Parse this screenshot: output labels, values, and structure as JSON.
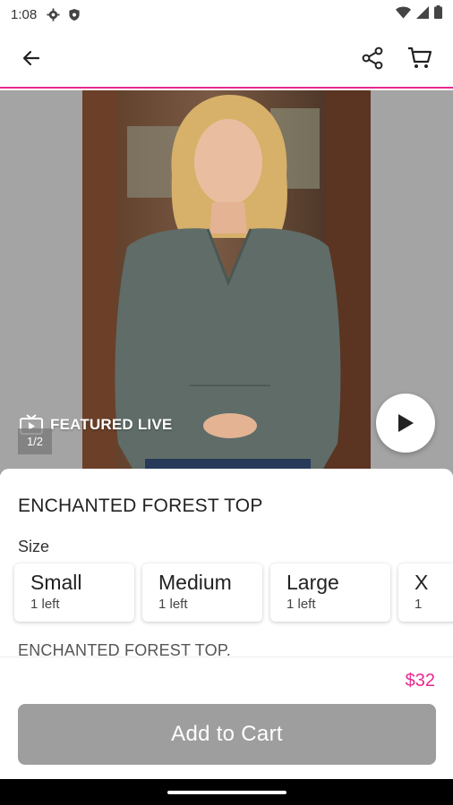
{
  "status_bar": {
    "time": "1:08",
    "icons": [
      "gear-icon",
      "shield-icon",
      "wifi-icon",
      "signal-icon",
      "battery-icon"
    ]
  },
  "header": {
    "back_icon": "arrow-left-icon",
    "share_icon": "share-icon",
    "cart_icon": "cart-icon",
    "accent_color": "#e8288f"
  },
  "media": {
    "featured_label": "FEATURED LIVE",
    "page_indicator": "1/2",
    "play_icon": "play-icon"
  },
  "product": {
    "title": "ENCHANTED FOREST TOP",
    "size_label": "Size",
    "sizes": [
      {
        "name": "Small",
        "stock": "1 left"
      },
      {
        "name": "Medium",
        "stock": "1 left"
      },
      {
        "name": "Large",
        "stock": "1 left"
      },
      {
        "name": "X",
        "stock": "1"
      }
    ],
    "description": "ENCHANTED FOREST TOP.",
    "price": "$32",
    "price_color": "#e8288f",
    "add_to_cart_label": "Add to Cart",
    "button_color": "#9e9e9e"
  }
}
